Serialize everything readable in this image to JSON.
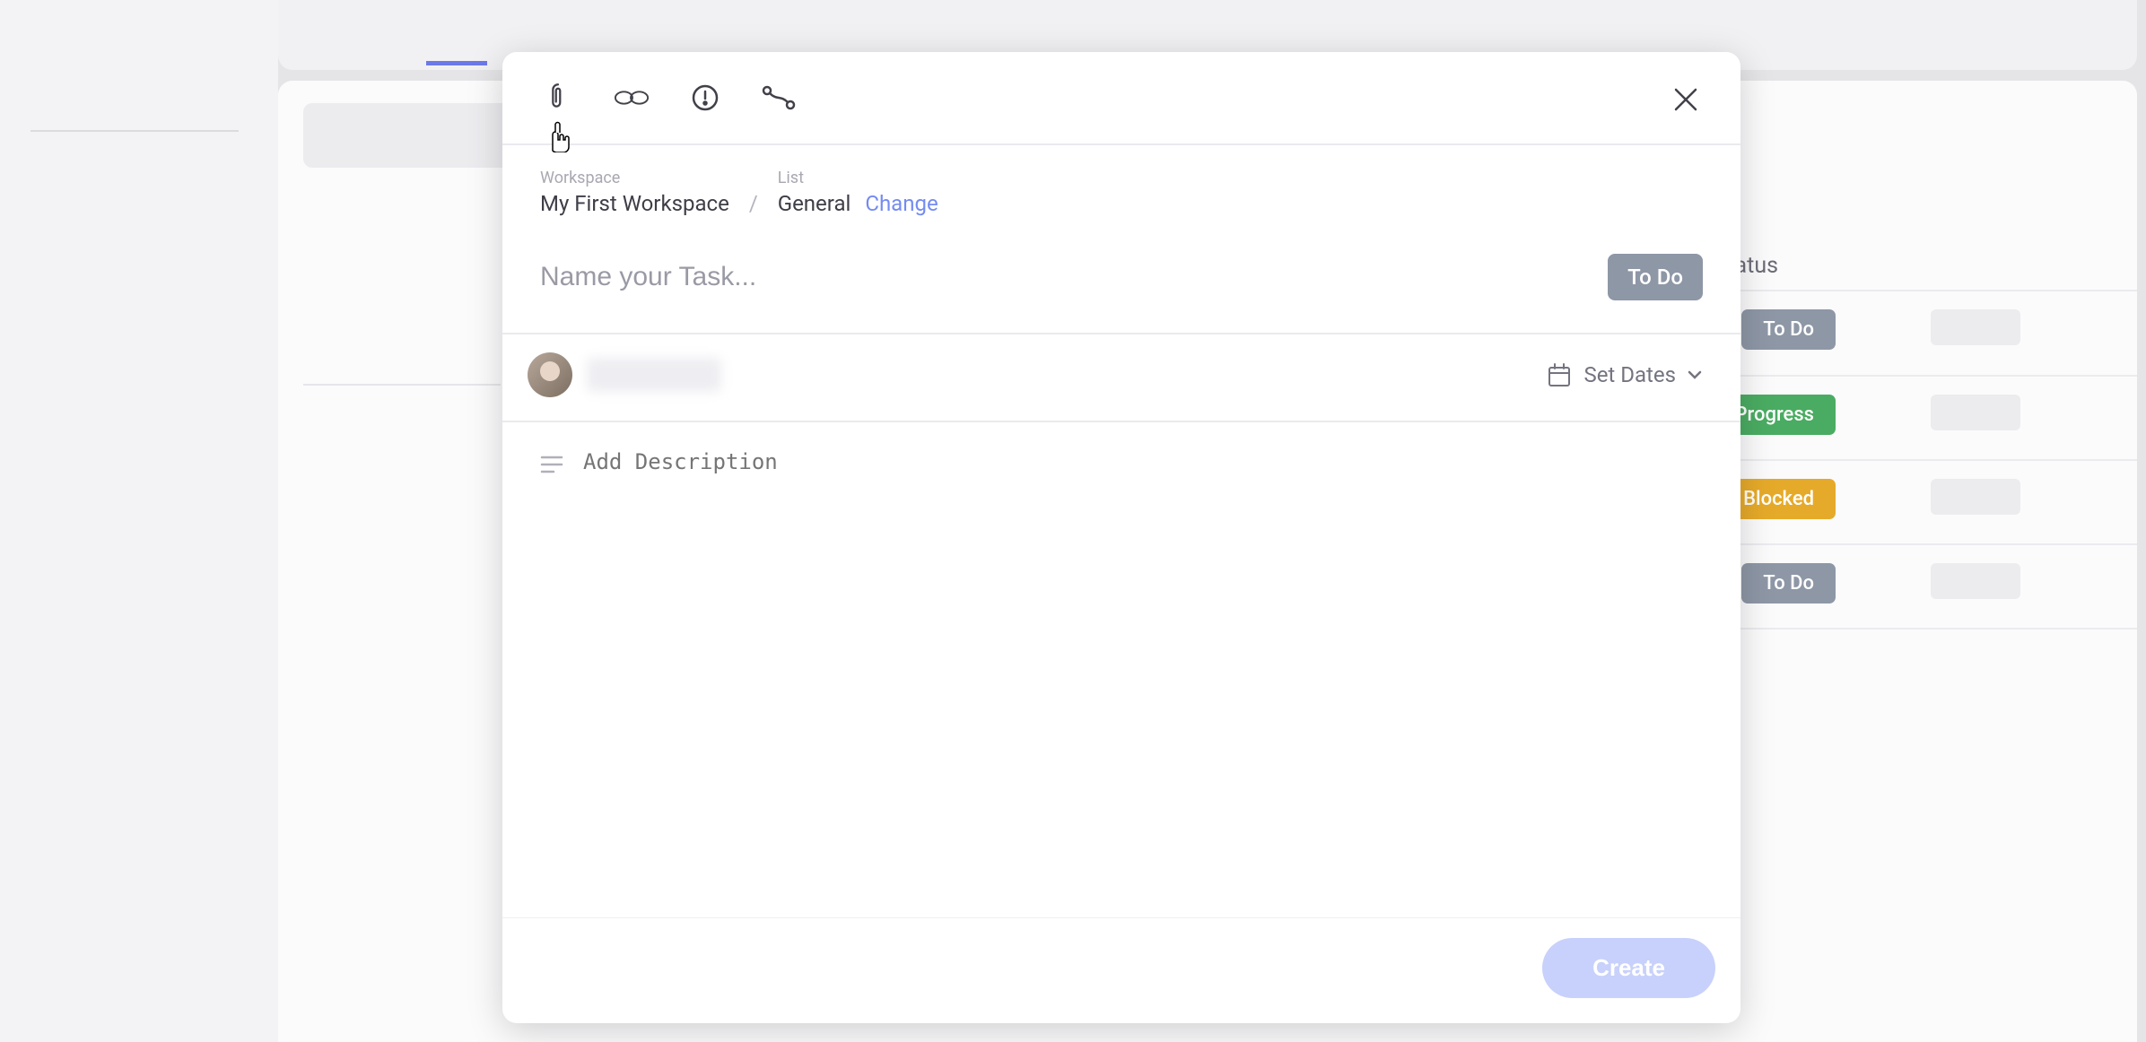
{
  "background": {
    "status_header": "Status",
    "rows": [
      {
        "status": "To Do",
        "class": "todo"
      },
      {
        "status": "In Progress",
        "class": "inprogress"
      },
      {
        "status": "Blocked",
        "class": "blocked"
      },
      {
        "status": "To Do",
        "class": "todo"
      }
    ]
  },
  "modal": {
    "breadcrumb": {
      "workspace_label": "Workspace",
      "workspace_value": "My First Workspace",
      "list_label": "List",
      "list_value": "General",
      "change_label": "Change"
    },
    "title_placeholder": "Name your Task...",
    "status_pill": "To Do",
    "set_dates_label": "Set Dates",
    "description_placeholder": "Add Description",
    "create_label": "Create"
  }
}
